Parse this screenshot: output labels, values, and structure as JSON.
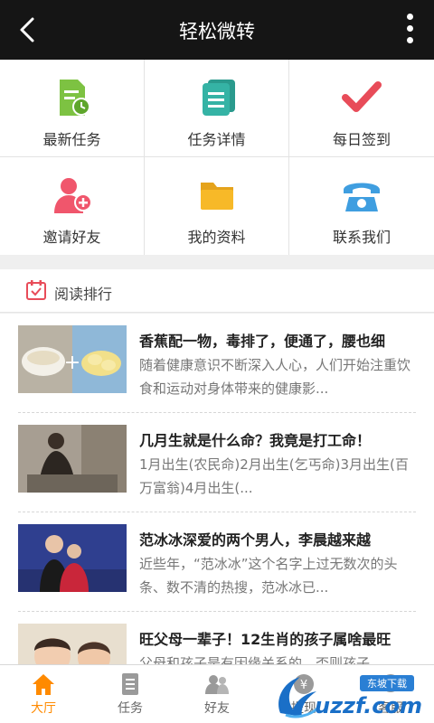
{
  "header": {
    "title": "轻松微转"
  },
  "grid": [
    {
      "label": "最新任务",
      "icon": "document-clock-icon"
    },
    {
      "label": "任务详情",
      "icon": "stacked-list-icon"
    },
    {
      "label": "每日签到",
      "icon": "check-icon"
    },
    {
      "label": "邀请好友",
      "icon": "add-user-icon"
    },
    {
      "label": "我的资料",
      "icon": "folder-icon"
    },
    {
      "label": "联系我们",
      "icon": "telephone-icon"
    }
  ],
  "section": {
    "title": "阅读排行"
  },
  "articles": [
    {
      "title": "香蕉配一物，毒排了，便通了，腰也细",
      "desc": "随着健康意识不断深入人心，人们开始注重饮食和运动对身体带来的健康影..."
    },
    {
      "title": "几月生就是什么命？我竟是打工命！",
      "desc": "1月出生(农民命)2月出生(乞丐命)3月出生(百万富翁)4月出生(..."
    },
    {
      "title": "范冰冰深爱的两个男人，李晨越来越",
      "desc": "近些年，“范冰冰”这个名字上过无数次的头条、数不清的热搜，范冰冰已..."
    },
    {
      "title": "旺父母一辈子！12生肖的孩子属啥最旺",
      "desc": "父母和孩子是有因缘关系的，否则孩子..."
    }
  ],
  "tabs": [
    {
      "label": "大厅",
      "icon": "home-icon",
      "active": true
    },
    {
      "label": "任务",
      "icon": "task-book-icon",
      "active": false
    },
    {
      "label": "好友",
      "icon": "friends-icon",
      "active": false
    },
    {
      "label": "提现",
      "icon": "withdraw-icon",
      "active": false
    },
    {
      "label": "客服",
      "icon": "service-icon",
      "active": false
    }
  ],
  "watermark": {
    "text": "uzzf.com",
    "badge": "东坡下载"
  },
  "colors": {
    "topbar": "#151515",
    "accent": "#ff8a00",
    "green": "#7dc242",
    "teal": "#35b3a5",
    "red": "#e84c59",
    "pink": "#f0566c",
    "yellow": "#f7b928",
    "blue": "#3f9ee0"
  }
}
